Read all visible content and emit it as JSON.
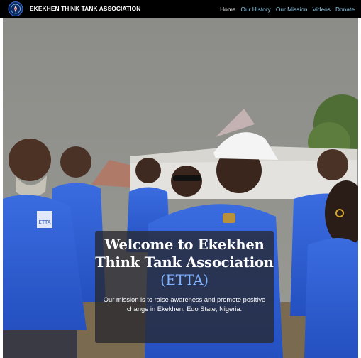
{
  "brand": {
    "name": "EKEKHEN THINK TANK ASSOCIATION",
    "logo_icon": "association-logo-icon"
  },
  "nav": {
    "items": [
      {
        "label": "Home",
        "active": true
      },
      {
        "label": "Our History",
        "active": false
      },
      {
        "label": "Our Mission",
        "active": false
      },
      {
        "label": "Videos",
        "active": false
      },
      {
        "label": "Donate",
        "active": false
      }
    ]
  },
  "hero": {
    "title_main": "Welcome to Ekekhen Think Tank Association",
    "title_acronym": "(ETTA)",
    "mission": "Our mission is to raise awareness and promote positive change in Ekekhen, Edo State, Nigeria.",
    "shirt_text": "ETTA"
  },
  "colors": {
    "navbar_bg": "#000000",
    "nav_link": "#8ec9e8",
    "nav_active": "#ffffff",
    "shirt_blue": "#2f5fd6",
    "acronym": "#7fb3ff",
    "overlay": "#282830"
  }
}
